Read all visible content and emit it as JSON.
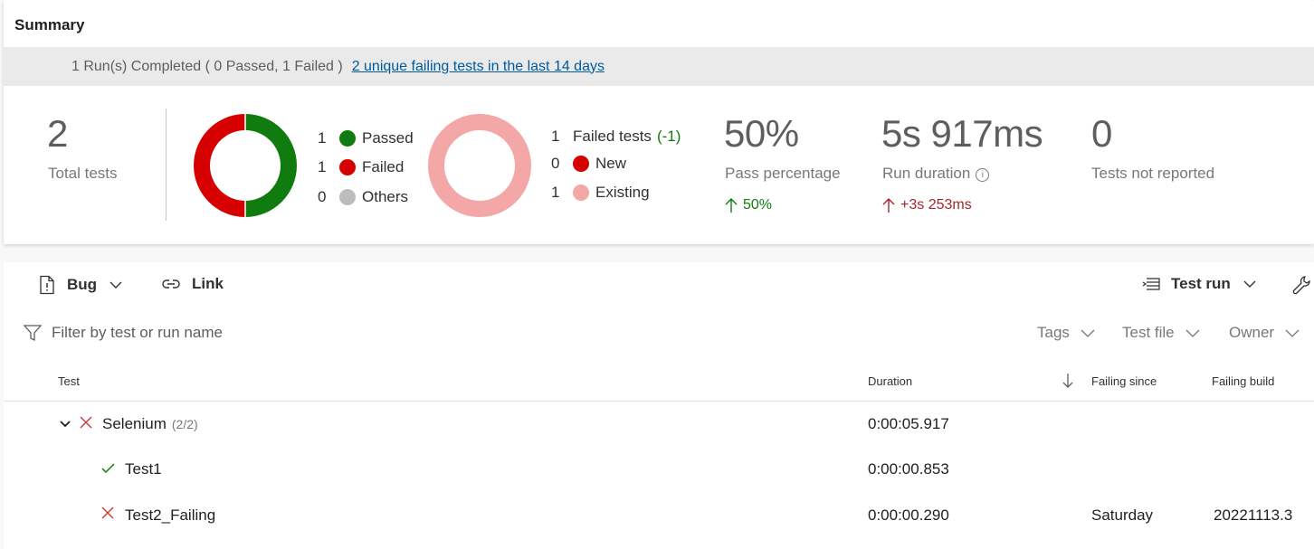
{
  "summary": {
    "title": "Summary",
    "runs_text": "1 Run(s) Completed ( 0 Passed, 1 Failed )",
    "failing_link": "2 unique failing tests in the last 14 days"
  },
  "metrics": {
    "total_tests": {
      "value": "2",
      "label": "Total tests"
    },
    "outcome_chart": {
      "slices": [
        {
          "count": "1",
          "label": "Passed",
          "color": "#107c10"
        },
        {
          "count": "1",
          "label": "Failed",
          "color": "#d70000"
        },
        {
          "count": "0",
          "label": "Others",
          "color": "#bdbdbd"
        }
      ]
    },
    "failed_chart": {
      "header_count": "1",
      "header_label": "Failed tests",
      "header_delta": "(-1)",
      "slices": [
        {
          "count": "0",
          "label": "New",
          "color": "#d70000"
        },
        {
          "count": "1",
          "label": "Existing",
          "color": "#f4a7a7"
        }
      ]
    },
    "pass_percentage": {
      "value": "50%",
      "label": "Pass percentage",
      "trend": "50%",
      "trend_color": "#107c10"
    },
    "run_duration": {
      "value": "5s 917ms",
      "label": "Run duration",
      "trend": "+3s 253ms",
      "trend_color": "#a4262c"
    },
    "not_reported": {
      "value": "0",
      "label": "Tests not reported"
    }
  },
  "toolbar": {
    "bug_label": "Bug",
    "link_label": "Link",
    "test_run_label": "Test run"
  },
  "filter": {
    "placeholder": "Filter by test or run name",
    "tags": "Tags",
    "test_file": "Test file",
    "owner": "Owner"
  },
  "table": {
    "headers": {
      "test": "Test",
      "duration": "Duration",
      "failing_since": "Failing since",
      "failing_build": "Failing build"
    },
    "rows": [
      {
        "name": "Selenium",
        "count": "(2/2)",
        "status": "failed",
        "duration": "0:00:05.917",
        "failing_since": "",
        "failing_build": ""
      },
      {
        "name": "Test1",
        "status": "passed",
        "duration": "0:00:00.853",
        "failing_since": "",
        "failing_build": ""
      },
      {
        "name": "Test2_Failing",
        "status": "failed",
        "duration": "0:00:00.290",
        "failing_since": "Saturday",
        "failing_build": "20221113.3"
      }
    ]
  }
}
